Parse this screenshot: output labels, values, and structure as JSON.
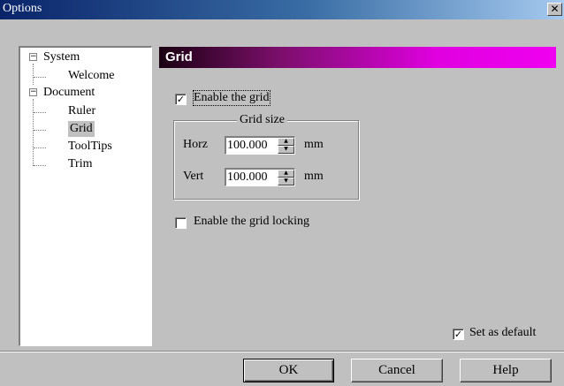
{
  "window": {
    "title": "Options",
    "close_glyph": "✕"
  },
  "tree": {
    "items": [
      {
        "label": "System",
        "level": 0,
        "expander": "−"
      },
      {
        "label": "Welcome",
        "level": 1
      },
      {
        "label": "Document",
        "level": 0,
        "expander": "−"
      },
      {
        "label": "Ruler",
        "level": 1
      },
      {
        "label": "Grid",
        "level": 1,
        "selected": true
      },
      {
        "label": "ToolTips",
        "level": 1
      },
      {
        "label": "Trim",
        "level": 1
      }
    ]
  },
  "panel": {
    "title": "Grid",
    "header_colors": [
      "#1a0012",
      "#f000f0"
    ]
  },
  "grid": {
    "enable_label": "Enable the grid",
    "enable_checked": "✓",
    "group_title": "Grid size",
    "horz_label": "Horz",
    "horz_value": "100.000",
    "horz_unit": "mm",
    "vert_label": "Vert",
    "vert_value": "100.000",
    "vert_unit": "mm",
    "locking_label": "Enable the grid locking",
    "locking_checked": ""
  },
  "default_option": {
    "label": "Set as default",
    "checked": "✓"
  },
  "buttons": {
    "ok": "OK",
    "cancel": "Cancel",
    "help": "Help"
  },
  "icons": {
    "spin_up": "up-arrow-icon",
    "spin_down": "down-arrow-icon",
    "check": "checkmark-icon",
    "expander": "minus-box-icon"
  }
}
